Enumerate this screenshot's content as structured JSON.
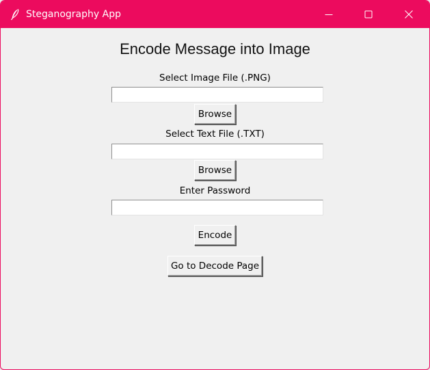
{
  "window": {
    "title": "Steganography App",
    "app_icon": "feather-icon",
    "accent_color": "#ec0b5e",
    "controls": {
      "minimize": "minimize-icon",
      "maximize": "maximize-icon",
      "close": "close-icon"
    }
  },
  "main": {
    "heading": "Encode Message into Image",
    "image_file": {
      "label": "Select Image File (.PNG)",
      "value": "",
      "browse_label": "Browse"
    },
    "text_file": {
      "label": "Select Text File (.TXT)",
      "value": "",
      "browse_label": "Browse"
    },
    "password": {
      "label": "Enter Password",
      "value": ""
    },
    "encode_label": "Encode",
    "decode_page_label": "Go to Decode Page"
  }
}
